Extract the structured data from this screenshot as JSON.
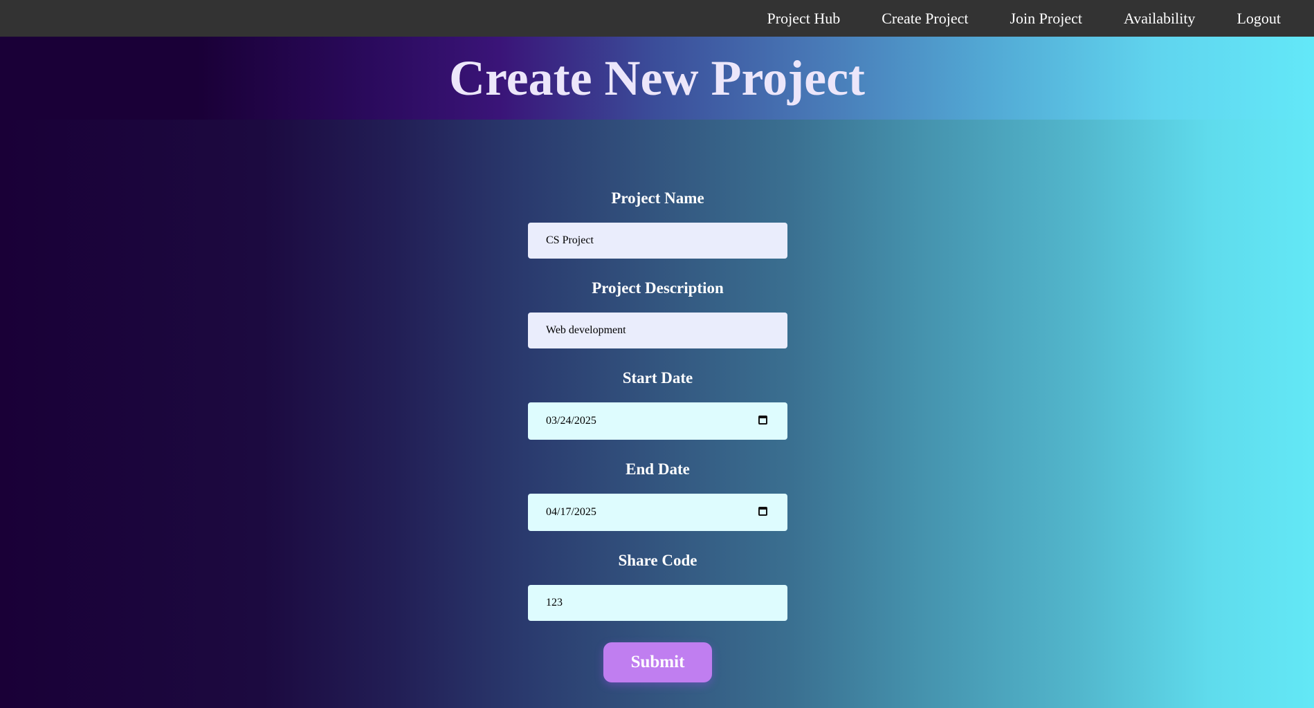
{
  "nav": {
    "items": [
      {
        "label": "Project Hub"
      },
      {
        "label": "Create Project"
      },
      {
        "label": "Join Project"
      },
      {
        "label": "Availability"
      },
      {
        "label": "Logout"
      }
    ]
  },
  "header": {
    "title": "Create New Project"
  },
  "form": {
    "project_name": {
      "label": "Project Name",
      "value": "CS Project"
    },
    "project_description": {
      "label": "Project Description",
      "value": "Web development"
    },
    "start_date": {
      "label": "Start Date",
      "value": "03/24/2025"
    },
    "end_date": {
      "label": "End Date",
      "value": "04/17/2025"
    },
    "share_code": {
      "label": "Share Code",
      "value": "123"
    },
    "submit_label": "Submit"
  },
  "colors": {
    "navbar": "#333333",
    "submit": "#c07ef0",
    "input_text_bg": "#eaedfc",
    "input_light_bg": "#defcfe"
  },
  "icons": {
    "date_picker": "calendar-icon"
  }
}
